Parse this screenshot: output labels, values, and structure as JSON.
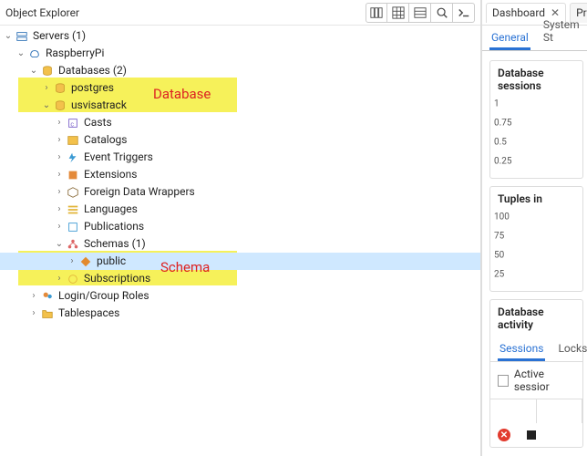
{
  "header": {
    "title": "Object Explorer",
    "toolbar_icons": [
      "columns-icon",
      "grid-icon",
      "list-icon",
      "search-icon",
      "terminal-icon"
    ]
  },
  "annotations": {
    "database": "Database",
    "schema": "Schema"
  },
  "tree": {
    "servers_label": "Servers (1)",
    "server_name": "RaspberryPi",
    "databases_label": "Databases (2)",
    "db_postgres": "postgres",
    "db_usvisatrack": "usvisatrack",
    "casts": "Casts",
    "catalogs": "Catalogs",
    "event_triggers": "Event Triggers",
    "extensions": "Extensions",
    "fdw": "Foreign Data Wrappers",
    "languages": "Languages",
    "publications": "Publications",
    "schemas_label": "Schemas (1)",
    "schema_public": "public",
    "subscriptions": "Subscriptions",
    "login_roles": "Login/Group Roles",
    "tablespaces": "Tablespaces"
  },
  "right": {
    "tabs": {
      "dashboard": "Dashboard",
      "properties": "Proper"
    },
    "subtabs": {
      "general": "General",
      "system": "System St"
    },
    "cards": {
      "sessions_title": "Database sessions",
      "tuples_in_title": "Tuples in",
      "activity_title": "Database activity"
    },
    "activity_tabs": {
      "sessions": "Sessions",
      "locks": "Locks"
    },
    "active_sessions_label": "Active sessior"
  },
  "chart_data": [
    {
      "type": "line",
      "title": "Database sessions",
      "xlabel": "",
      "ylabel": "",
      "ylim": [
        0,
        1
      ],
      "yticks": [
        1,
        0.75,
        0.5,
        0.25
      ],
      "series": []
    },
    {
      "type": "line",
      "title": "Tuples in",
      "xlabel": "",
      "ylabel": "",
      "ylim": [
        0,
        100
      ],
      "yticks": [
        100,
        75,
        50,
        25
      ],
      "series": []
    }
  ]
}
